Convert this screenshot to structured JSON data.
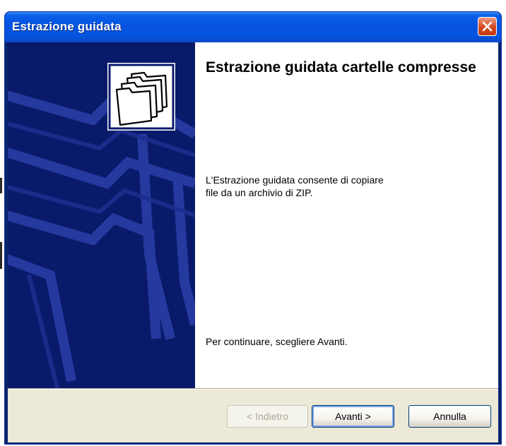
{
  "window": {
    "title": "Estrazione guidata"
  },
  "wizard": {
    "heading": "Estrazione guidata cartelle compresse",
    "description": "L'Estrazione guidata consente di copiare\nfile da un archivio di ZIP.",
    "continue_hint": "Per continuare, scegliere Avanti."
  },
  "buttons": {
    "back": "< Indietro",
    "next": "Avanti >",
    "cancel": "Annulla"
  },
  "colors": {
    "titlebar": "#0553e0",
    "banner": "#0a1a6b",
    "dialog_face": "#ece9d8",
    "close_button": "#d6491f"
  },
  "icons": {
    "close": "close-icon",
    "wizard": "folders-icon",
    "banner": "folder-watermark"
  }
}
